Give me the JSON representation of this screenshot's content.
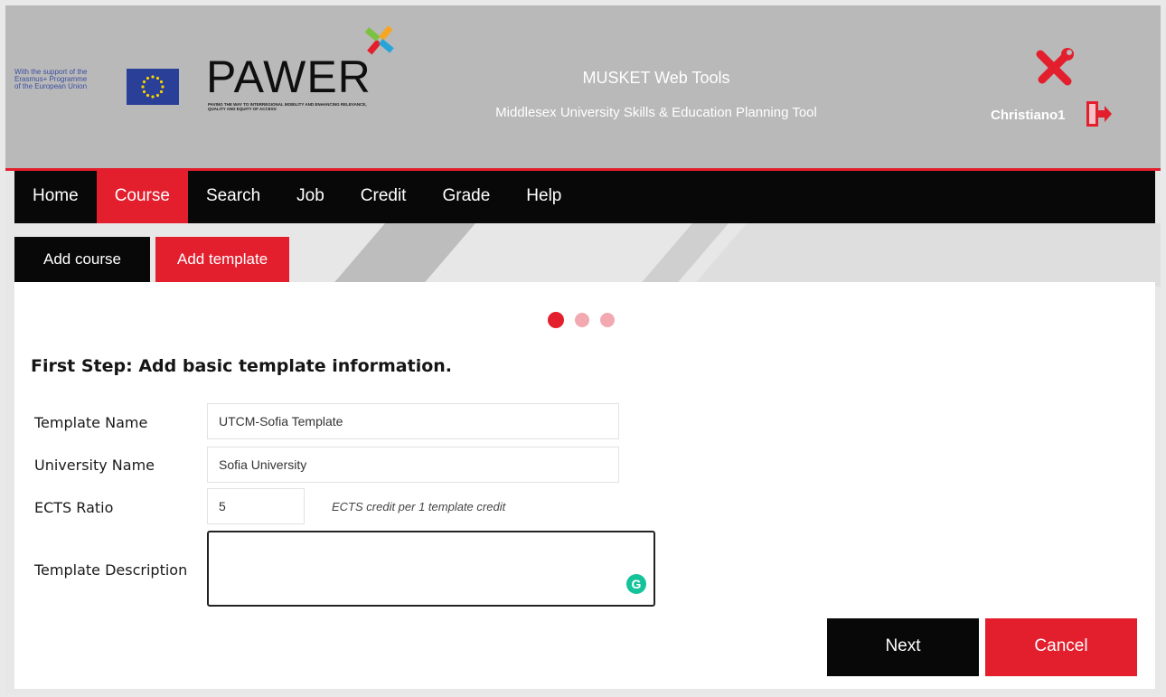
{
  "header": {
    "eu_support_text": "With the support of the\nErasmus+ Programme\nof the European Union",
    "logo_title": "PAWER",
    "logo_subtitle": "Paving the way to interregional mobility and enhancing relevance, quality and equity of access",
    "app_title": "MUSKET Web Tools",
    "app_subtitle": "Middlesex University Skills & Education Planning Tool",
    "username": "Christiano1",
    "icons": [
      "eu-flag-icon",
      "pawer-logo-icon",
      "tools-icon",
      "logout-icon"
    ]
  },
  "nav": {
    "items": [
      {
        "label": "Home",
        "active": false
      },
      {
        "label": "Course",
        "active": true
      },
      {
        "label": "Search",
        "active": false
      },
      {
        "label": "Job",
        "active": false
      },
      {
        "label": "Credit",
        "active": false
      },
      {
        "label": "Grade",
        "active": false
      },
      {
        "label": "Help",
        "active": false
      }
    ]
  },
  "subtabs": {
    "add_course": "Add course",
    "add_template": "Add template"
  },
  "form": {
    "steps": {
      "current": 1,
      "total": 3
    },
    "heading": "First Step: Add basic template information.",
    "template_name_label": "Template Name",
    "template_name_value": "UTCM-Sofia Template",
    "university_name_label": "University Name",
    "university_name_value": "Sofia University",
    "ects_ratio_label": "ECTS Ratio",
    "ects_ratio_value": "5",
    "ects_hint": "ECTS credit per 1 template credit",
    "description_label": "Template Description",
    "description_value": "",
    "next_label": "Next",
    "cancel_label": "Cancel"
  },
  "colors": {
    "accent": "#e31e2d",
    "dark": "#080808",
    "header_bg": "#b9b9b9",
    "grammarly": "#15c39a"
  }
}
